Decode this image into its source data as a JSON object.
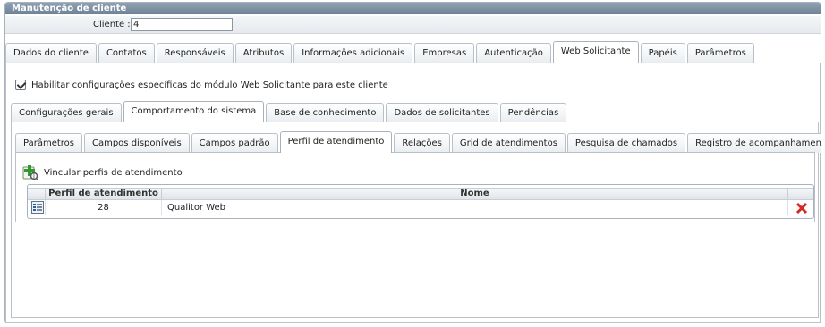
{
  "window": {
    "title": "Manutenção de cliente"
  },
  "client": {
    "label": "Cliente :",
    "value": "4"
  },
  "main_tabs": [
    {
      "label": "Dados do cliente",
      "active": false
    },
    {
      "label": "Contatos",
      "active": false
    },
    {
      "label": "Responsáveis",
      "active": false
    },
    {
      "label": "Atributos",
      "active": false
    },
    {
      "label": "Informações adicionais",
      "active": false
    },
    {
      "label": "Empresas",
      "active": false
    },
    {
      "label": "Autenticação",
      "active": false
    },
    {
      "label": "Web Solicitante",
      "active": true
    },
    {
      "label": "Papéis",
      "active": false
    },
    {
      "label": "Parâmetros",
      "active": false
    }
  ],
  "enable_checkbox": {
    "label": "Habilitar configurações específicas do módulo Web Solicitante para este cliente",
    "checked": true
  },
  "sub_tabs": [
    {
      "label": "Configurações gerais",
      "active": false
    },
    {
      "label": "Comportamento do sistema",
      "active": true
    },
    {
      "label": "Base de conhecimento",
      "active": false
    },
    {
      "label": "Dados de solicitantes",
      "active": false
    },
    {
      "label": "Pendências",
      "active": false
    }
  ],
  "inner_tabs": [
    {
      "label": "Parâmetros",
      "active": false
    },
    {
      "label": "Campos disponíveis",
      "active": false
    },
    {
      "label": "Campos padrão",
      "active": false
    },
    {
      "label": "Perfil de atendimento",
      "active": true
    },
    {
      "label": "Relações",
      "active": false
    },
    {
      "label": "Grid de atendimentos",
      "active": false
    },
    {
      "label": "Pesquisa de chamados",
      "active": false
    },
    {
      "label": "Registro de acompanhamentos",
      "active": false
    }
  ],
  "link_profiles": {
    "label": "Vincular perfis de atendimento",
    "icon": "add-profile-icon"
  },
  "grid": {
    "columns": [
      "Perfil de atendimento",
      "Nome"
    ],
    "rows": [
      {
        "profile": "28",
        "name": "Qualitor Web"
      }
    ]
  },
  "colors": {
    "titlebar": "#7b8ea1",
    "delete": "#d42a1f",
    "add": "#2f9a2f"
  }
}
